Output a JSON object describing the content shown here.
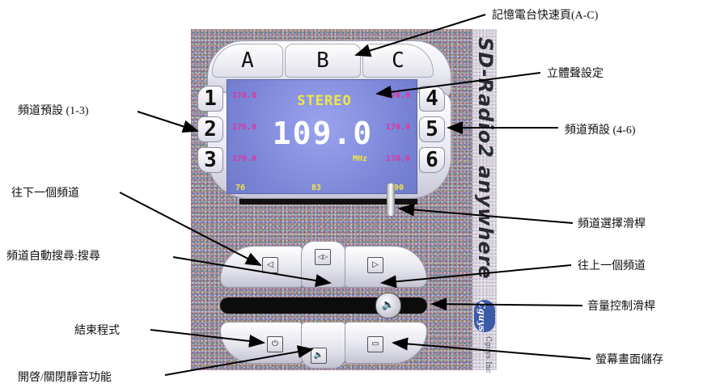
{
  "device": {
    "app_title": "SD-Radio2 anywhere",
    "company_name": "Cguys Inc",
    "logo_text": "Cguys"
  },
  "memory_pages": {
    "tabs": [
      "A",
      "B",
      "C"
    ]
  },
  "presets": {
    "left_labels": [
      "1",
      "2",
      "3"
    ],
    "right_labels": [
      "4",
      "5",
      "6"
    ],
    "left_freqs": [
      "176.0",
      "176.0",
      "176.0"
    ],
    "right_freqs": [
      "176.0",
      "176.0",
      "176.0"
    ]
  },
  "lcd": {
    "stereo_text": "STEREO",
    "frequency": "109.0",
    "unit": "MHz",
    "scale": [
      "76",
      "83",
      "90"
    ]
  },
  "controls": {
    "prev_icon": "◁",
    "seek_icon": "◁▷",
    "next_icon": "▷",
    "exit_icon": "⏻",
    "mute_icon": "🔈",
    "snapshot_icon": "▭",
    "volume_icon": "🔈",
    "volume_level": 0.8,
    "tuning_position": 0.85
  },
  "callouts": {
    "memory_pages": "記憶電台快速頁(A-C)",
    "stereo": "立體聲設定",
    "presets_left": "頻道預設 (1-3)",
    "presets_right": "頻道預設 (4-6)",
    "prev_channel": "往下一個頻道",
    "tuning_slider": "頻道選擇滑桿",
    "seek": "頻道自動搜尋:搜尋",
    "next_channel": "往上一個頻道",
    "volume_slider": "音量控制滑桿",
    "exit": "結束程式",
    "snapshot": "螢幕畫面儲存",
    "mute": "開啓/關閉靜音功能"
  }
}
